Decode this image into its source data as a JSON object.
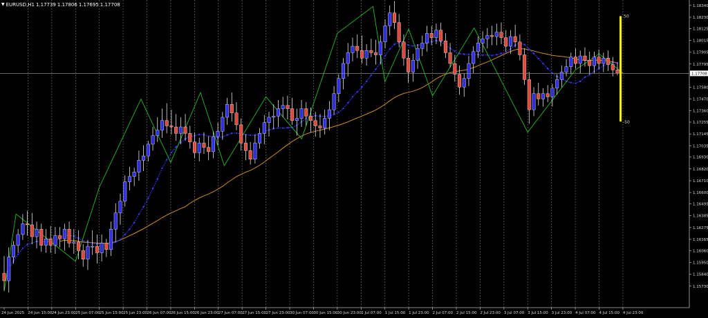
{
  "window": {
    "symbol": "EURUSD,H1",
    "ohlc": [
      "1.17739",
      "1.17806",
      "1.17695",
      "1.17708"
    ]
  },
  "chart_data": {
    "type": "candlestick",
    "title": "",
    "ylim": [
      1.1553,
      1.1839
    ],
    "grid_vertical": true,
    "grid_horizontal": false,
    "current_price": 1.17708,
    "current_price_label": "1.17708",
    "colors": {
      "background": "#000000",
      "bull_candle": "#2f2fe0",
      "bear_candle": "#e0483c",
      "zigzag": "#22bb22",
      "moving_average": "#d08c1e",
      "blue_ma": "#3a3aff",
      "price_line": "#8a8a8a",
      "grid": "#6a6a6a",
      "axis_text": "#dddddd",
      "gauge": "#ffee00"
    },
    "y_ticks": [
      "1.18340",
      "1.18230",
      "1.18125",
      "1.18015",
      "1.17905",
      "1.17795",
      "1.17580",
      "1.17470",
      "1.17360",
      "1.17255",
      "1.17145",
      "1.17035",
      "1.16930",
      "1.16820",
      "1.16710",
      "1.16600",
      "1.16495",
      "1.16385",
      "1.16275",
      "1.16165",
      "1.16060",
      "1.15950",
      "1.15840",
      "1.15730"
    ],
    "x_ticks": [
      "24 Jun 2025",
      "24 Jun 15:00",
      "24 Jun 23:00",
      "25 Jun 07:00",
      "25 Jun 15:00",
      "25 Jun 23:00",
      "26 Jun 07:00",
      "26 Jun 15:00",
      "26 Jun 23:00",
      "27 Jun 07:00",
      "27 Jun 15:00",
      "27 Jun 23:00",
      "30 Jun 07:00",
      "30 Jun 15:00",
      "30 Jun 23:00",
      "1 Jul 07:00",
      "1 Jul 15:00",
      "1 Jul 23:00",
      "2 Jul 07:00",
      "2 Jul 15:00",
      "2 Jul 23:00",
      "3 Jul 07:00",
      "3 Jul 15:00",
      "3 Jul 23:00",
      "4 Jul 07:00",
      "4 Jul 15:00",
      "4 Jul 23:00"
    ],
    "zigzag": [
      {
        "x": "24 Jun 2025",
        "y": 1.1568
      },
      {
        "x": "24 Jun 11:00",
        "y": 1.164
      },
      {
        "x": "25 Jun 07:00",
        "y": 1.1596
      },
      {
        "x": "25 Jun 15:00",
        "y": 1.1665
      },
      {
        "x": "26 Jun 05:00",
        "y": 1.1747
      },
      {
        "x": "26 Jun 15:00",
        "y": 1.1688
      },
      {
        "x": "27 Jun 01:00",
        "y": 1.1753
      },
      {
        "x": "27 Jun 09:00",
        "y": 1.1685
      },
      {
        "x": "27 Jun 23:00",
        "y": 1.1749
      },
      {
        "x": "30 Jun 11:00",
        "y": 1.171
      },
      {
        "x": "30 Jun 23:00",
        "y": 1.1808
      },
      {
        "x": "1 Jul 11:00",
        "y": 1.1833
      },
      {
        "x": "1 Jul 15:00",
        "y": 1.1763
      },
      {
        "x": "1 Jul 23:00",
        "y": 1.1812
      },
      {
        "x": "2 Jul 07:00",
        "y": 1.175
      },
      {
        "x": "2 Jul 21:00",
        "y": 1.1813
      },
      {
        "x": "3 Jul 15:00",
        "y": 1.1716
      },
      {
        "x": "4 Jul 07:00",
        "y": 1.1774
      },
      {
        "x": "4 Jul 15:00",
        "y": 1.1789
      },
      {
        "x": "4 Jul 23:00",
        "y": 1.1771
      }
    ],
    "gauge": {
      "top_label": "50",
      "bottom_label": "-50"
    },
    "series": [
      {
        "key": "candles",
        "values": [
          [
            1.1585,
            1.1601,
            1.1569,
            1.1578
          ],
          [
            1.1578,
            1.1609,
            1.1567,
            1.16
          ],
          [
            1.16,
            1.1615,
            1.1594,
            1.1611
          ],
          [
            1.1611,
            1.1626,
            1.1604,
            1.1621
          ],
          [
            1.1621,
            1.164,
            1.1616,
            1.1631
          ],
          [
            1.1631,
            1.1643,
            1.162,
            1.163
          ],
          [
            1.163,
            1.1641,
            1.1612,
            1.1619
          ],
          [
            1.1619,
            1.1633,
            1.1608,
            1.1626
          ],
          [
            1.1626,
            1.1631,
            1.1605,
            1.1611
          ],
          [
            1.1611,
            1.1626,
            1.1604,
            1.1617
          ],
          [
            1.1617,
            1.1629,
            1.1604,
            1.1611
          ],
          [
            1.1611,
            1.1628,
            1.1603,
            1.162
          ],
          [
            1.162,
            1.1628,
            1.1609,
            1.1617
          ],
          [
            1.1617,
            1.1631,
            1.1606,
            1.1626
          ],
          [
            1.1626,
            1.1633,
            1.1609,
            1.1613
          ],
          [
            1.1613,
            1.1626,
            1.1603,
            1.1614
          ],
          [
            1.1614,
            1.1625,
            1.1598,
            1.1606
          ],
          [
            1.1606,
            1.1612,
            1.1591,
            1.1598
          ],
          [
            1.1598,
            1.1616,
            1.1588,
            1.161
          ],
          [
            1.161,
            1.1625,
            1.1602,
            1.161
          ],
          [
            1.161,
            1.1621,
            1.1594,
            1.1604
          ],
          [
            1.1604,
            1.1621,
            1.1596,
            1.1613
          ],
          [
            1.1613,
            1.1617,
            1.16,
            1.1607
          ],
          [
            1.1607,
            1.1633,
            1.1601,
            1.1626
          ],
          [
            1.1626,
            1.165,
            1.1614,
            1.1641
          ],
          [
            1.1641,
            1.1659,
            1.163,
            1.1652
          ],
          [
            1.1652,
            1.1676,
            1.1647,
            1.167
          ],
          [
            1.167,
            1.1684,
            1.1662,
            1.1675
          ],
          [
            1.1675,
            1.1683,
            1.1666,
            1.1679
          ],
          [
            1.1679,
            1.1699,
            1.1671,
            1.169
          ],
          [
            1.169,
            1.1704,
            1.168,
            1.1694
          ],
          [
            1.1694,
            1.1708,
            1.1689,
            1.1705
          ],
          [
            1.1705,
            1.1721,
            1.1699,
            1.1713
          ],
          [
            1.1713,
            1.173,
            1.1707,
            1.1718
          ],
          [
            1.1718,
            1.1738,
            1.1711,
            1.1727
          ],
          [
            1.1727,
            1.1743,
            1.1715,
            1.1722
          ],
          [
            1.1722,
            1.1737,
            1.1714,
            1.1721
          ],
          [
            1.1721,
            1.1733,
            1.1708,
            1.1715
          ],
          [
            1.1715,
            1.173,
            1.1705,
            1.1721
          ],
          [
            1.1721,
            1.1733,
            1.1708,
            1.1715
          ],
          [
            1.1715,
            1.1722,
            1.1701,
            1.1707
          ],
          [
            1.1707,
            1.1716,
            1.1692,
            1.1697
          ],
          [
            1.1697,
            1.1711,
            1.1689,
            1.1706
          ],
          [
            1.1706,
            1.1716,
            1.1696,
            1.1702
          ],
          [
            1.1702,
            1.1712,
            1.169,
            1.1698
          ],
          [
            1.1698,
            1.1717,
            1.1692,
            1.1712
          ],
          [
            1.1712,
            1.1725,
            1.1704,
            1.1717
          ],
          [
            1.1717,
            1.1735,
            1.1709,
            1.173
          ],
          [
            1.173,
            1.1748,
            1.1723,
            1.1742
          ],
          [
            1.1742,
            1.1753,
            1.1726,
            1.1734
          ],
          [
            1.1734,
            1.1744,
            1.1718,
            1.1723
          ],
          [
            1.1723,
            1.1729,
            1.1699,
            1.1706
          ],
          [
            1.1706,
            1.1714,
            1.169,
            1.1699
          ],
          [
            1.1699,
            1.1707,
            1.1686,
            1.1691
          ],
          [
            1.1691,
            1.1714,
            1.1687,
            1.1706
          ],
          [
            1.1706,
            1.172,
            1.1701,
            1.1715
          ],
          [
            1.1715,
            1.1732,
            1.1705,
            1.1725
          ],
          [
            1.1725,
            1.1735,
            1.1712,
            1.173
          ],
          [
            1.173,
            1.1742,
            1.1719,
            1.1731
          ],
          [
            1.1731,
            1.1746,
            1.1721,
            1.1738
          ],
          [
            1.1738,
            1.1749,
            1.173,
            1.1741
          ],
          [
            1.1741,
            1.175,
            1.1728,
            1.1738
          ],
          [
            1.1738,
            1.1748,
            1.1723,
            1.1727
          ],
          [
            1.1727,
            1.1738,
            1.1713,
            1.1729
          ],
          [
            1.1729,
            1.1746,
            1.1721,
            1.1738
          ],
          [
            1.1738,
            1.1744,
            1.1722,
            1.1731
          ],
          [
            1.1731,
            1.1739,
            1.1716,
            1.1727
          ],
          [
            1.1727,
            1.1735,
            1.1712,
            1.1722
          ],
          [
            1.1722,
            1.1733,
            1.1711,
            1.172
          ],
          [
            1.172,
            1.1737,
            1.1714,
            1.1729
          ],
          [
            1.1729,
            1.1745,
            1.1718,
            1.1737
          ],
          [
            1.1737,
            1.1759,
            1.1733,
            1.1752
          ],
          [
            1.1752,
            1.177,
            1.1744,
            1.1766
          ],
          [
            1.1766,
            1.1785,
            1.1756,
            1.178
          ],
          [
            1.178,
            1.1799,
            1.1768,
            1.179
          ],
          [
            1.179,
            1.1804,
            1.1782,
            1.1796
          ],
          [
            1.1796,
            1.1807,
            1.1785,
            1.1792
          ],
          [
            1.1792,
            1.1806,
            1.178,
            1.1785
          ],
          [
            1.1785,
            1.1798,
            1.1778,
            1.1792
          ],
          [
            1.1792,
            1.1803,
            1.1786,
            1.179
          ],
          [
            1.179,
            1.1802,
            1.1779,
            1.1788
          ],
          [
            1.1788,
            1.1806,
            1.1779,
            1.18
          ],
          [
            1.18,
            1.1821,
            1.1794,
            1.1815
          ],
          [
            1.1815,
            1.1834,
            1.1806,
            1.1827
          ],
          [
            1.1827,
            1.1838,
            1.1812,
            1.1818
          ],
          [
            1.1818,
            1.1826,
            1.1795,
            1.18
          ],
          [
            1.18,
            1.1807,
            1.1778,
            1.1785
          ],
          [
            1.1785,
            1.1793,
            1.1762,
            1.1772
          ],
          [
            1.1772,
            1.1789,
            1.1763,
            1.1783
          ],
          [
            1.1783,
            1.1798,
            1.1775,
            1.1794
          ],
          [
            1.1794,
            1.1806,
            1.1787,
            1.1799
          ],
          [
            1.1799,
            1.1815,
            1.1791,
            1.1808
          ],
          [
            1.1808,
            1.1815,
            1.1797,
            1.1804
          ],
          [
            1.1804,
            1.1817,
            1.1798,
            1.1811
          ],
          [
            1.1811,
            1.1818,
            1.1796,
            1.1801
          ],
          [
            1.1801,
            1.1808,
            1.1785,
            1.179
          ],
          [
            1.179,
            1.1799,
            1.1776,
            1.178
          ],
          [
            1.178,
            1.1788,
            1.1763,
            1.177
          ],
          [
            1.177,
            1.1778,
            1.1751,
            1.1758
          ],
          [
            1.1758,
            1.1771,
            1.1749,
            1.1766
          ],
          [
            1.1766,
            1.1787,
            1.1759,
            1.178
          ],
          [
            1.178,
            1.1796,
            1.1771,
            1.1791
          ],
          [
            1.1791,
            1.1805,
            1.1785,
            1.1799
          ],
          [
            1.1799,
            1.181,
            1.179,
            1.1803
          ],
          [
            1.1803,
            1.1813,
            1.1794,
            1.1806
          ],
          [
            1.1806,
            1.1815,
            1.1797,
            1.1805
          ],
          [
            1.1805,
            1.1817,
            1.1797,
            1.1809
          ],
          [
            1.1809,
            1.1818,
            1.1798,
            1.1804
          ],
          [
            1.1804,
            1.1811,
            1.1791,
            1.1796
          ],
          [
            1.1796,
            1.1811,
            1.1789,
            1.1805
          ],
          [
            1.1805,
            1.1816,
            1.1795,
            1.18
          ],
          [
            1.18,
            1.1807,
            1.1783,
            1.1788
          ],
          [
            1.1788,
            1.1794,
            1.176,
            1.1765
          ],
          [
            1.1765,
            1.1772,
            1.1724,
            1.1737
          ],
          [
            1.1737,
            1.1758,
            1.1731,
            1.1752
          ],
          [
            1.1752,
            1.1762,
            1.1741,
            1.1747
          ],
          [
            1.1747,
            1.1757,
            1.174,
            1.1752
          ],
          [
            1.1752,
            1.176,
            1.1744,
            1.1749
          ],
          [
            1.1749,
            1.1761,
            1.174,
            1.1757
          ],
          [
            1.1757,
            1.177,
            1.1751,
            1.1765
          ],
          [
            1.1765,
            1.1778,
            1.1758,
            1.1772
          ],
          [
            1.1772,
            1.1784,
            1.1768,
            1.1777
          ],
          [
            1.1777,
            1.179,
            1.177,
            1.1786
          ],
          [
            1.1786,
            1.1794,
            1.1775,
            1.178
          ],
          [
            1.178,
            1.1792,
            1.1771,
            1.1787
          ],
          [
            1.1787,
            1.1795,
            1.1777,
            1.1783
          ],
          [
            1.1783,
            1.1791,
            1.177,
            1.1778
          ],
          [
            1.1778,
            1.1791,
            1.1771,
            1.1786
          ],
          [
            1.1786,
            1.1793,
            1.1775,
            1.178
          ],
          [
            1.178,
            1.179,
            1.1772,
            1.1785
          ],
          [
            1.1785,
            1.1792,
            1.1773,
            1.1779
          ],
          [
            1.1779,
            1.1786,
            1.1768,
            1.1774
          ],
          [
            1.1774,
            1.1781,
            1.1769,
            1.1771
          ]
        ]
      }
    ]
  }
}
